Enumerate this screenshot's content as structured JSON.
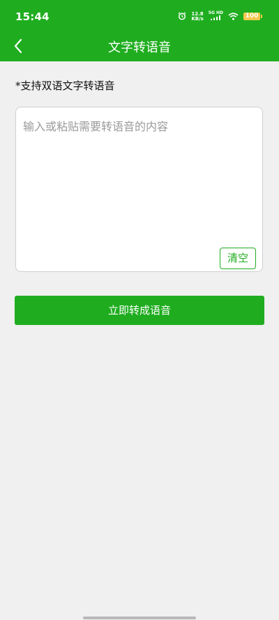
{
  "status_bar": {
    "time": "15:44",
    "speed_value": "12.8",
    "speed_unit": "KB/s",
    "network": "5G HD",
    "battery": "100"
  },
  "nav": {
    "title": "文字转语音"
  },
  "hint": "*支持双语文字转语音",
  "input": {
    "value": "",
    "placeholder": "输入或粘贴需要转语音的内容"
  },
  "clear_label": "清空",
  "convert_label": "立即转成语音",
  "colors": {
    "accent": "#1fad1f",
    "background": "#f0f0f0"
  }
}
